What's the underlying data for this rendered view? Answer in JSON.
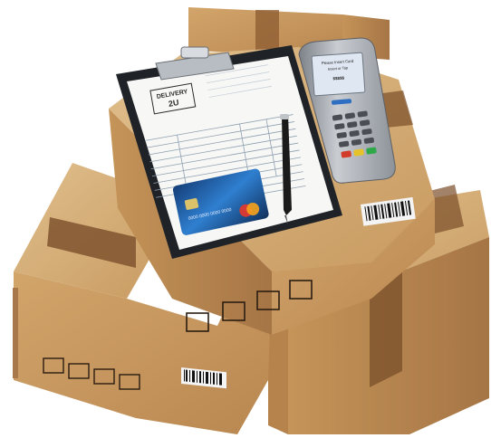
{
  "scene": {
    "subject": "",
    "delivery_note": {
      "stamp_line1": "DELIVERY",
      "stamp_line2": "2U"
    },
    "card_terminal": {
      "screen_line1": "Please Insert Card",
      "screen_line2": "Insert or Tap",
      "screen_line3": "$$$$$"
    },
    "credit_card": {
      "number_line": "0000 0000 0000 0000"
    },
    "colors": {
      "cardboard": "#c99c62",
      "cardboard_dark": "#a9784a",
      "cardboard_light": "#ddb983",
      "tape": "#7a4f2a",
      "clipboard": "#1f2328",
      "terminal_body": "#9fa4aa",
      "terminal_screen": "#dfe8f2",
      "card_blue": "#1f5fa8"
    }
  }
}
